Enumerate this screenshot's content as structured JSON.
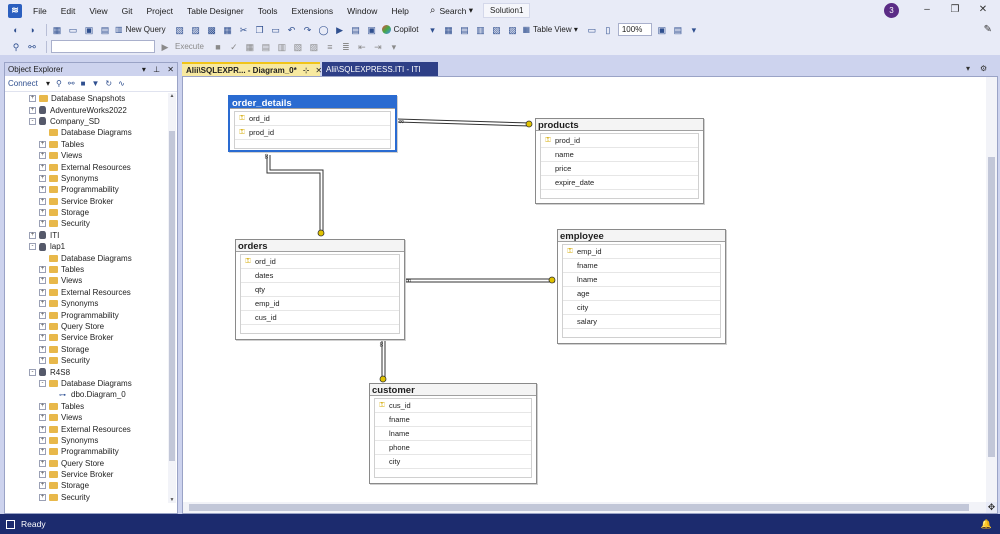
{
  "menubar": {
    "items": [
      "File",
      "Edit",
      "View",
      "Git",
      "Project",
      "Table Designer",
      "Tools",
      "Extensions",
      "Window",
      "Help"
    ],
    "search_label": "Search",
    "solution": "Solution1",
    "avatar_initial": "3"
  },
  "toolbar": {
    "new_query": "New Query",
    "copilot": "Copilot",
    "table_view": "Table View",
    "zoom": "100%",
    "execute": "Execute"
  },
  "object_explorer": {
    "title": "Object Explorer",
    "connect": "Connect",
    "tree": [
      {
        "level": 0,
        "expander": "+",
        "icon": "folder",
        "label": "Database Snapshots"
      },
      {
        "level": 0,
        "expander": "+",
        "icon": "db",
        "label": "AdventureWorks2022"
      },
      {
        "level": 0,
        "expander": "-",
        "icon": "db",
        "label": "Company_SD"
      },
      {
        "level": 1,
        "expander": "",
        "icon": "folder",
        "label": "Database Diagrams"
      },
      {
        "level": 1,
        "expander": "+",
        "icon": "folder",
        "label": "Tables"
      },
      {
        "level": 1,
        "expander": "+",
        "icon": "folder",
        "label": "Views"
      },
      {
        "level": 1,
        "expander": "+",
        "icon": "folder",
        "label": "External Resources"
      },
      {
        "level": 1,
        "expander": "+",
        "icon": "folder",
        "label": "Synonyms"
      },
      {
        "level": 1,
        "expander": "+",
        "icon": "folder",
        "label": "Programmability"
      },
      {
        "level": 1,
        "expander": "+",
        "icon": "folder",
        "label": "Service Broker"
      },
      {
        "level": 1,
        "expander": "+",
        "icon": "folder",
        "label": "Storage"
      },
      {
        "level": 1,
        "expander": "+",
        "icon": "folder",
        "label": "Security"
      },
      {
        "level": 0,
        "expander": "+",
        "icon": "db",
        "label": "ITI"
      },
      {
        "level": 0,
        "expander": "-",
        "icon": "db",
        "label": "lap1"
      },
      {
        "level": 1,
        "expander": "",
        "icon": "folder",
        "label": "Database Diagrams"
      },
      {
        "level": 1,
        "expander": "+",
        "icon": "folder",
        "label": "Tables"
      },
      {
        "level": 1,
        "expander": "+",
        "icon": "folder",
        "label": "Views"
      },
      {
        "level": 1,
        "expander": "+",
        "icon": "folder",
        "label": "External Resources"
      },
      {
        "level": 1,
        "expander": "+",
        "icon": "folder",
        "label": "Synonyms"
      },
      {
        "level": 1,
        "expander": "+",
        "icon": "folder",
        "label": "Programmability"
      },
      {
        "level": 1,
        "expander": "+",
        "icon": "folder",
        "label": "Query Store"
      },
      {
        "level": 1,
        "expander": "+",
        "icon": "folder",
        "label": "Service Broker"
      },
      {
        "level": 1,
        "expander": "+",
        "icon": "folder",
        "label": "Storage"
      },
      {
        "level": 1,
        "expander": "+",
        "icon": "folder",
        "label": "Security"
      },
      {
        "level": 0,
        "expander": "-",
        "icon": "db",
        "label": "R4S8"
      },
      {
        "level": 1,
        "expander": "-",
        "icon": "folder",
        "label": "Database Diagrams"
      },
      {
        "level": 2,
        "expander": "",
        "icon": "diagram",
        "label": "dbo.Diagram_0"
      },
      {
        "level": 1,
        "expander": "+",
        "icon": "folder",
        "label": "Tables"
      },
      {
        "level": 1,
        "expander": "+",
        "icon": "folder",
        "label": "Views"
      },
      {
        "level": 1,
        "expander": "+",
        "icon": "folder",
        "label": "External Resources"
      },
      {
        "level": 1,
        "expander": "+",
        "icon": "folder",
        "label": "Synonyms"
      },
      {
        "level": 1,
        "expander": "+",
        "icon": "folder",
        "label": "Programmability"
      },
      {
        "level": 1,
        "expander": "+",
        "icon": "folder",
        "label": "Query Store"
      },
      {
        "level": 1,
        "expander": "+",
        "icon": "folder",
        "label": "Service Broker"
      },
      {
        "level": 1,
        "expander": "+",
        "icon": "folder",
        "label": "Storage"
      },
      {
        "level": 1,
        "expander": "+",
        "icon": "folder",
        "label": "Security"
      }
    ]
  },
  "tabs": {
    "active": "Alii\\SQLEXPR... - Diagram_0*",
    "inactive": "Alii\\SQLEXPRESS.ITI - ITI"
  },
  "diagram": {
    "tables": {
      "order_details": {
        "title": "order_details",
        "columns": [
          {
            "name": "ord_id",
            "key": true
          },
          {
            "name": "prod_id",
            "key": true
          }
        ]
      },
      "products": {
        "title": "products",
        "columns": [
          {
            "name": "prod_id",
            "key": true
          },
          {
            "name": "name",
            "key": false
          },
          {
            "name": "price",
            "key": false
          },
          {
            "name": "expire_date",
            "key": false
          }
        ]
      },
      "orders": {
        "title": "orders",
        "columns": [
          {
            "name": "ord_id",
            "key": true
          },
          {
            "name": "dates",
            "key": false
          },
          {
            "name": "qty",
            "key": false
          },
          {
            "name": "emp_id",
            "key": false
          },
          {
            "name": "cus_id",
            "key": false
          }
        ]
      },
      "employee": {
        "title": "employee",
        "columns": [
          {
            "name": "emp_id",
            "key": true
          },
          {
            "name": "fname",
            "key": false
          },
          {
            "name": "lname",
            "key": false
          },
          {
            "name": "age",
            "key": false
          },
          {
            "name": "city",
            "key": false
          },
          {
            "name": "salary",
            "key": false
          }
        ]
      },
      "customer": {
        "title": "customer",
        "columns": [
          {
            "name": "cus_id",
            "key": true
          },
          {
            "name": "fname",
            "key": false
          },
          {
            "name": "lname",
            "key": false
          },
          {
            "name": "phone",
            "key": false
          },
          {
            "name": "city",
            "key": false
          }
        ]
      }
    },
    "key_color": "#d4a900",
    "selected_color": "#2a6bd1"
  },
  "status": {
    "text": "Ready"
  },
  "colors": {
    "chrome": "#e8ebf7",
    "statusbar": "#1c2b6e",
    "tab_active": "#f7e9a0",
    "tab_inactive": "#2e3f87"
  }
}
